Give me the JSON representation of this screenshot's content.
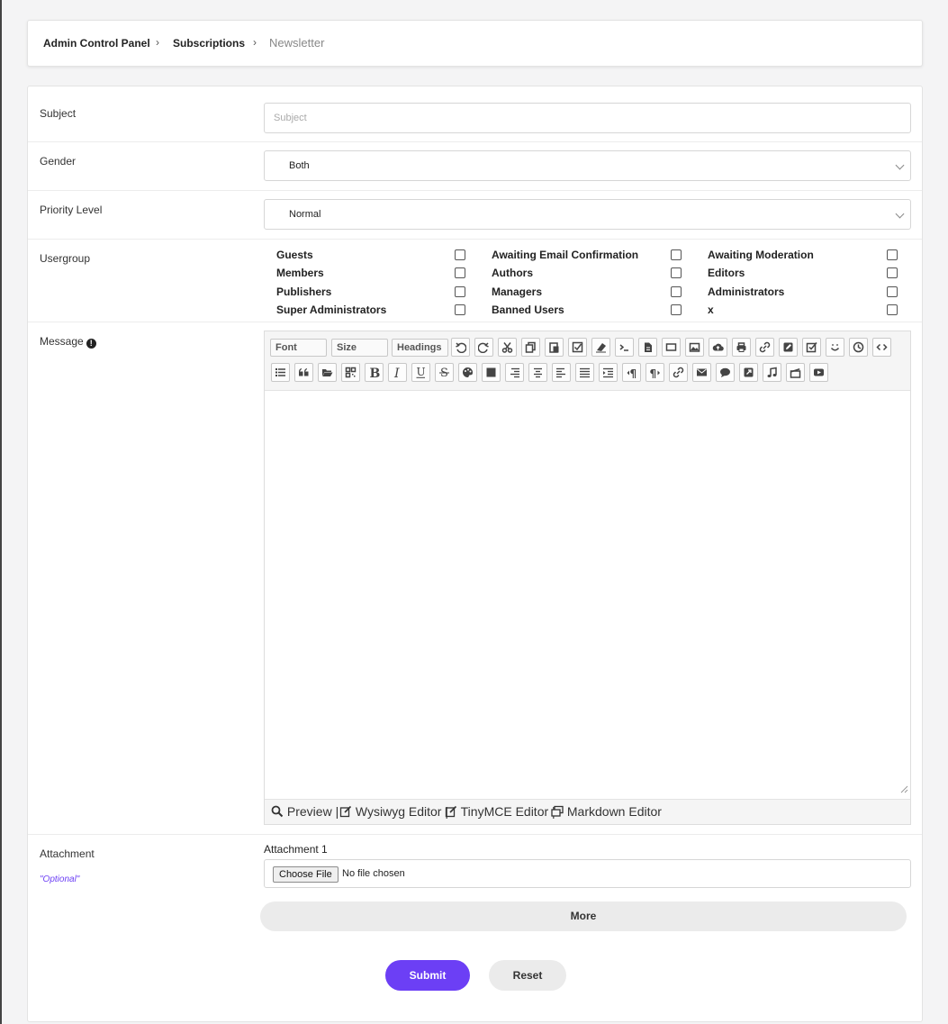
{
  "breadcrumb": {
    "items": [
      "Admin Control Panel",
      "Subscriptions",
      "Newsletter"
    ]
  },
  "form": {
    "subject": {
      "label": "Subject",
      "placeholder": "Subject",
      "value": ""
    },
    "gender": {
      "label": "Gender",
      "value": "Both"
    },
    "priority": {
      "label": "Priority Level",
      "value": "Normal"
    },
    "usergroup": {
      "label": "Usergroup",
      "options": [
        "Guests",
        "Awaiting Email Confirmation",
        "Awaiting Moderation",
        "Members",
        "Authors",
        "Editors",
        "Publishers",
        "Managers",
        "Administrators",
        "Super Administrators",
        "Banned Users",
        "x"
      ]
    },
    "message": {
      "label": "Message",
      "toolbar": {
        "font": "Font",
        "size": "Size",
        "headings": "Headings"
      },
      "footer": {
        "preview": "Preview |",
        "wysiwyg": "Wysiwyg Editor |",
        "tinymce": "TinyMCE Editor |",
        "markdown": "Markdown Editor"
      }
    },
    "attachment": {
      "label": "Attachment",
      "optional": "\"Optional\"",
      "title": "Attachment 1",
      "choose": "Choose File",
      "no_file": "No file chosen"
    },
    "more_label": "More",
    "submit_label": "Submit",
    "reset_label": "Reset"
  },
  "colors": {
    "accent": "#6c3ff5",
    "button_gray": "#ebebeb"
  }
}
